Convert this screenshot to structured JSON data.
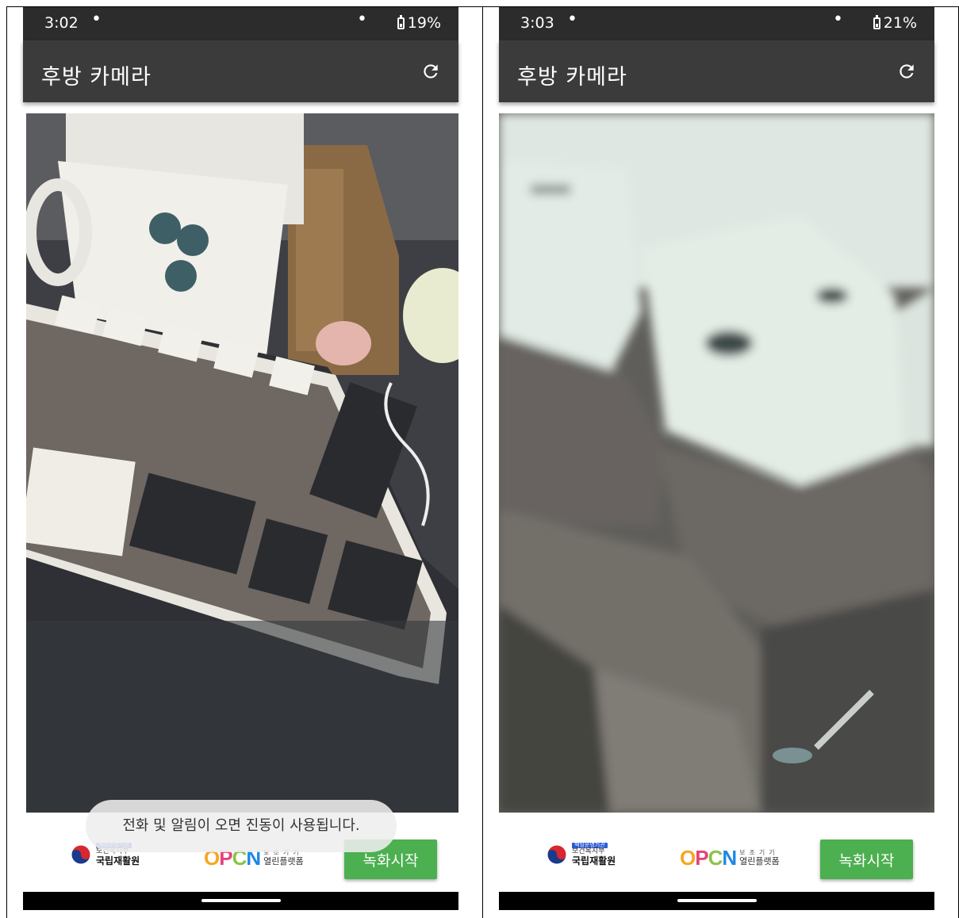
{
  "screens": [
    {
      "status_time": "3:02",
      "battery": "19%",
      "title": "후방 카메라",
      "record_label": "녹화시작",
      "toast": "전화 및 알림이 오면 진동이 사용됩니다."
    },
    {
      "status_time": "3:03",
      "battery": "21%",
      "title": "후방 카메라",
      "record_label": "녹화시작"
    }
  ],
  "logos": {
    "org_badge": "책임운영기관",
    "org_ministry": "보건복지부",
    "org_name": "국립재활원",
    "open_letters": [
      "O",
      "P",
      "C",
      "N"
    ],
    "open_sub_top": "보조기기",
    "open_sub_bottom": "열린플랫폼"
  },
  "colors": {
    "status_bar": "#2c2c2c",
    "app_bar": "#3b3b3b",
    "record_button": "#4caf50",
    "open_o": "#f5a623",
    "open_p": "#e8417a",
    "open_c": "#8bc34a",
    "open_n": "#1e88e5"
  },
  "icons": [
    "refresh-icon",
    "battery-charging-icon",
    "taeguk-logo"
  ]
}
